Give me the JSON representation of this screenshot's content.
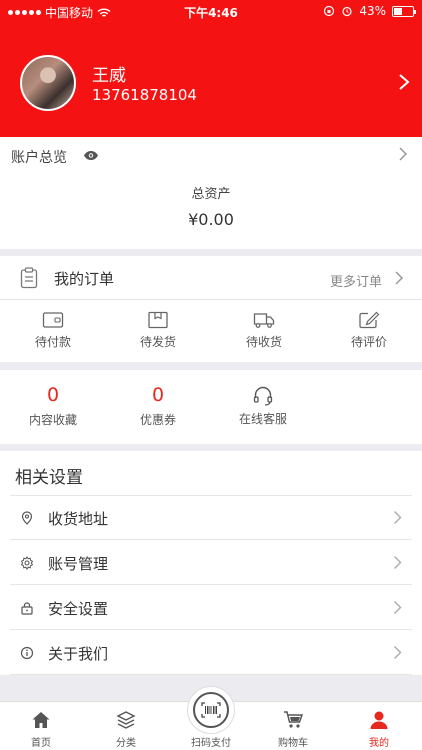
{
  "status_bar": {
    "carrier": "中国移动",
    "time": "下午4:46",
    "battery": "43%",
    "battery_level": 0.43
  },
  "profile": {
    "name": "王威",
    "phone": "13761878104"
  },
  "overview": {
    "title": "账户总览",
    "total_label": "总资产",
    "total_value": "¥0.00"
  },
  "orders": {
    "title": "我的订单",
    "more": "更多订单",
    "items": [
      {
        "label": "待付款",
        "icon": "wallet-icon"
      },
      {
        "label": "待发货",
        "icon": "box-icon"
      },
      {
        "label": "待收货",
        "icon": "truck-icon"
      },
      {
        "label": "待评价",
        "icon": "edit-icon"
      }
    ]
  },
  "stats": {
    "favorites_count": "0",
    "favorites_label": "内容收藏",
    "coupons_count": "0",
    "coupons_label": "优惠券",
    "service_label": "在线客服",
    "service_icon": "headset-icon"
  },
  "settings": {
    "title": "相关设置",
    "items": [
      {
        "label": "收货地址",
        "icon": "location-icon"
      },
      {
        "label": "账号管理",
        "icon": "gear-icon"
      },
      {
        "label": "安全设置",
        "icon": "lock-icon"
      },
      {
        "label": "关于我们",
        "icon": "info-icon"
      }
    ]
  },
  "tabbar": {
    "items": [
      {
        "label": "首页",
        "icon": "home-icon"
      },
      {
        "label": "分类",
        "icon": "layers-icon"
      },
      {
        "label": "扫码支付",
        "icon": "barcode-icon"
      },
      {
        "label": "购物车",
        "icon": "cart-icon"
      },
      {
        "label": "我的",
        "icon": "person-icon"
      }
    ],
    "active_index": 4
  },
  "colors": {
    "brand_red": "#f41212",
    "accent_red": "#e8281e"
  }
}
